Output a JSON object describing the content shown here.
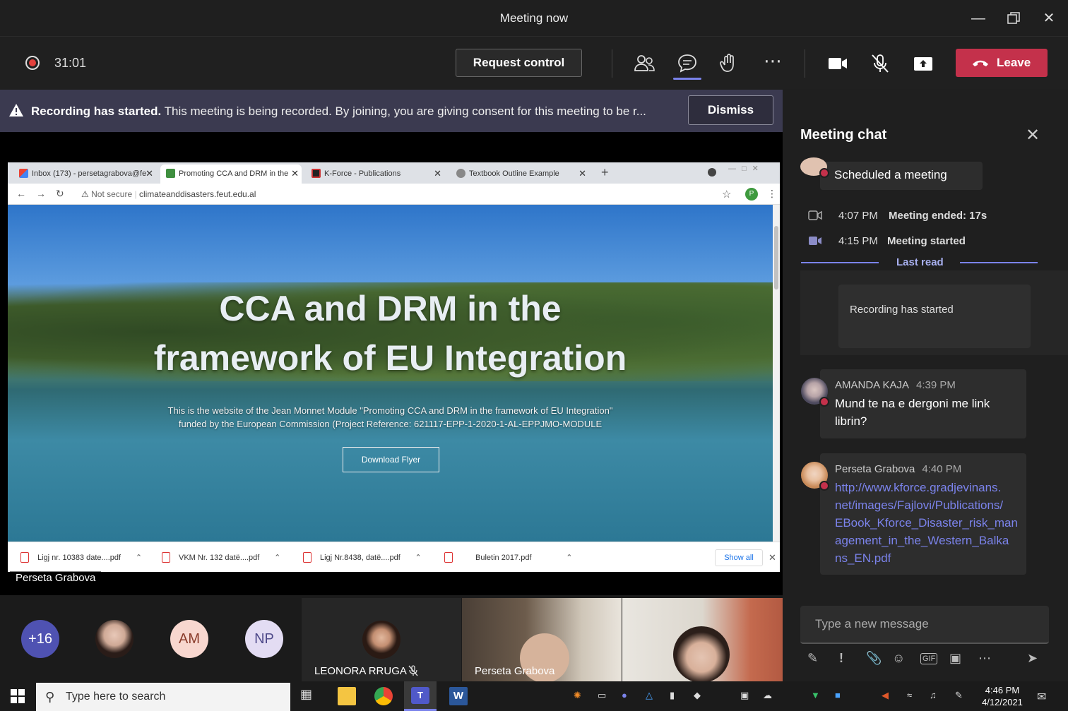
{
  "window": {
    "title": "Meeting now"
  },
  "toolbar": {
    "timer": "31:01",
    "request_control": "Request control",
    "leave": "Leave"
  },
  "banner": {
    "bold": "Recording has started.",
    "text": " This meeting is being recorded. By joining, you are giving consent for this meeting to be r...",
    "dismiss": "Dismiss"
  },
  "browser": {
    "tabs": [
      {
        "label": "Inbox (173) - persetagrabova@fe"
      },
      {
        "label": "Promoting CCA and DRM in the"
      },
      {
        "label": "K-Force - Publications"
      },
      {
        "label": "Textbook Outline Example"
      }
    ],
    "not_secure": "Not secure",
    "url": "climateanddisasters.feut.edu.al",
    "profile_initial": "P",
    "hero_line1": "CCA and DRM in the",
    "hero_line2": "framework of EU Integration",
    "hero_text1": "This is the website of the Jean Monnet Module \"Promoting CCA and DRM in the framework of EU Integration\"",
    "hero_text2": "funded by the European Commission (Project Reference: 621117-EPP-1-2020-1-AL-EPPJMO-MODULE",
    "flyer_button": "Download Flyer",
    "downloads": [
      {
        "name": "Ligj nr. 10383 date....pdf"
      },
      {
        "name": "VKM Nr. 132 datë....pdf"
      },
      {
        "name": "Ligj Nr.8438, datë....pdf"
      },
      {
        "name": "Buletin 2017.pdf"
      }
    ],
    "show_all": "Show all"
  },
  "presenter_label": "Perseta Grabova",
  "gallery": {
    "overflow": "+16",
    "am": "AM",
    "np": "NP",
    "leonora": "LEONORA RRUGA",
    "perseta": "Perseta Grabova"
  },
  "chat": {
    "title": "Meeting chat",
    "scheduled": "Scheduled a meeting",
    "events": [
      {
        "time": "4:07 PM",
        "text": "Meeting ended: 17s"
      },
      {
        "time": "4:15 PM",
        "text": "Meeting started"
      }
    ],
    "last_read": "Last read",
    "recording": "Recording has started",
    "messages": [
      {
        "name": "AMANDA KAJA",
        "time": "4:39 PM",
        "text": "Mund te na e dergoni me link librin?"
      },
      {
        "name": "Perseta Grabova",
        "time": "4:40 PM",
        "text": "http://www.kforce.gradjevinans.net/images/Fajlovi/Publications/EBook_Kforce_Disaster_risk_management_in_the_Western_Balkans_EN.pdf"
      }
    ],
    "link_lines": [
      "http://www.kforce.gradjevinans.",
      "net/images/Fajlovi/Publications/",
      "EBook_Kforce_Disaster_risk_man",
      "agement_in_the_Western_Balka",
      "ns_EN.pdf"
    ],
    "compose_placeholder": "Type a new message"
  },
  "taskbar": {
    "search": "Type here to search",
    "time": "4:46 PM",
    "date": "4/12/2021"
  }
}
